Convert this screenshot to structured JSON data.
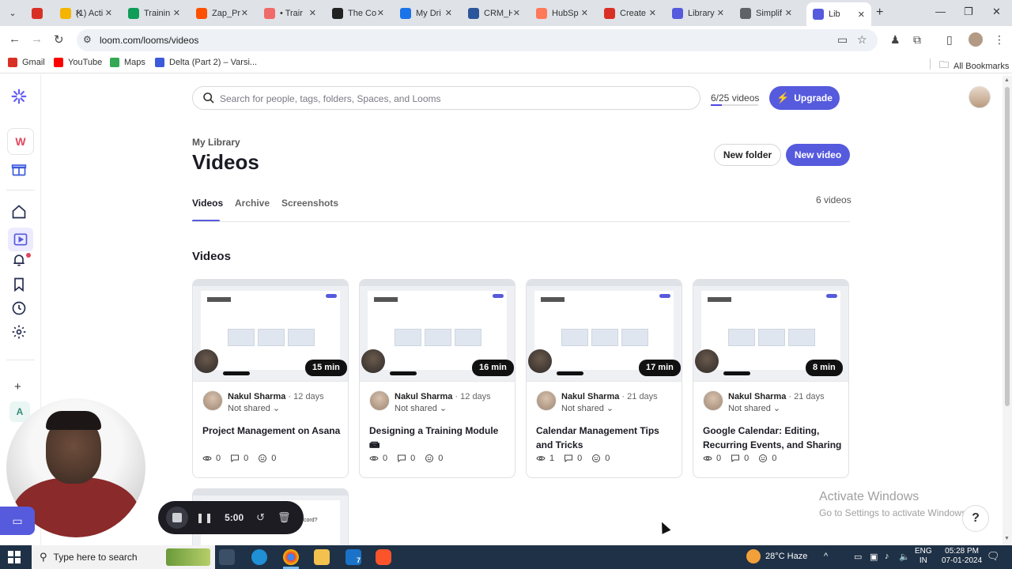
{
  "browser": {
    "tabs": [
      {
        "title": "",
        "color": "#d93025"
      },
      {
        "title": "(1) Acti",
        "color": "#f4b400"
      },
      {
        "title": "Trainin",
        "color": "#0f9d58"
      },
      {
        "title": "Zap_Pr",
        "color": "#ff4f00"
      },
      {
        "title": "• Trair",
        "color": "#f06a6a"
      },
      {
        "title": "The Co",
        "color": "#222222"
      },
      {
        "title": "My Dri",
        "color": "#1a73e8"
      },
      {
        "title": "CRM_H",
        "color": "#2b579a"
      },
      {
        "title": "HubSp",
        "color": "#ff7a59"
      },
      {
        "title": "Create",
        "color": "#d93025"
      },
      {
        "title": "Library",
        "color": "#565add"
      },
      {
        "title": "Simplif",
        "color": "#5f6368"
      },
      {
        "title": "Lib",
        "color": "#565add"
      }
    ],
    "url": "loom.com/looms/videos",
    "bookmarks": [
      {
        "label": "Gmail",
        "color": "#d93025"
      },
      {
        "label": "YouTube",
        "color": "#ff0000"
      },
      {
        "label": "Maps",
        "color": "#34a853"
      },
      {
        "label": "Delta (Part 2) – Varsi...",
        "color": "#3b5bdb"
      }
    ],
    "all_bookmarks": "All Bookmarks"
  },
  "rail": {
    "workspace_initial": "W",
    "space_initial": "A"
  },
  "header": {
    "search_placeholder": "Search for people, tags, folders, Spaces, and Looms",
    "video_count": "6/25 videos",
    "video_count_fraction": 0.24,
    "upgrade_label": "Upgrade"
  },
  "page": {
    "breadcrumb": "My Library",
    "title": "Videos",
    "new_folder": "New folder",
    "new_video": "New video",
    "total": "6 videos",
    "tabs": [
      "Videos",
      "Archive",
      "Screenshots"
    ],
    "section_title": "Videos"
  },
  "videos": [
    {
      "duration": "15 min",
      "author": "Nakul Sharma",
      "ago": " · 12 days",
      "sharing": "Not shared ⌄",
      "title": "Project Management on Asana",
      "views": "0",
      "comments": "0",
      "reactions": "0"
    },
    {
      "duration": "16 min",
      "author": "Nakul Sharma",
      "ago": " · 12 days",
      "sharing": "Not shared ⌄",
      "title": "Designing a Training Module 📾",
      "views": "0",
      "comments": "0",
      "reactions": "0"
    },
    {
      "duration": "17 min",
      "author": "Nakul Sharma",
      "ago": " · 21 days",
      "sharing": "Not shared ⌄",
      "title": "Calendar Management Tips and Tricks",
      "views": "1",
      "comments": "0",
      "reactions": "0"
    },
    {
      "duration": "8 min",
      "author": "Nakul Sharma",
      "ago": " · 21 days",
      "sharing": "Not shared ⌄",
      "title": "Google Calendar: Editing, Recurring Events, and Sharing",
      "views": "0",
      "comments": "0",
      "reactions": "0"
    }
  ],
  "partial_card_text": "cord?",
  "recorder": {
    "time": "5:00"
  },
  "watermark": {
    "line1": "Activate Windows",
    "line2": "Go to Settings to activate Windows."
  },
  "help_label": "?",
  "taskbar": {
    "search_placeholder": "Type here to search",
    "weather": "28°C  Haze",
    "lang_line1": "ENG",
    "lang_line2": "IN",
    "time": "05:28 PM",
    "date": "07-01-2024",
    "mail_badge": "7"
  },
  "colors": {
    "accent": "#565add",
    "brand": "#625df5"
  }
}
